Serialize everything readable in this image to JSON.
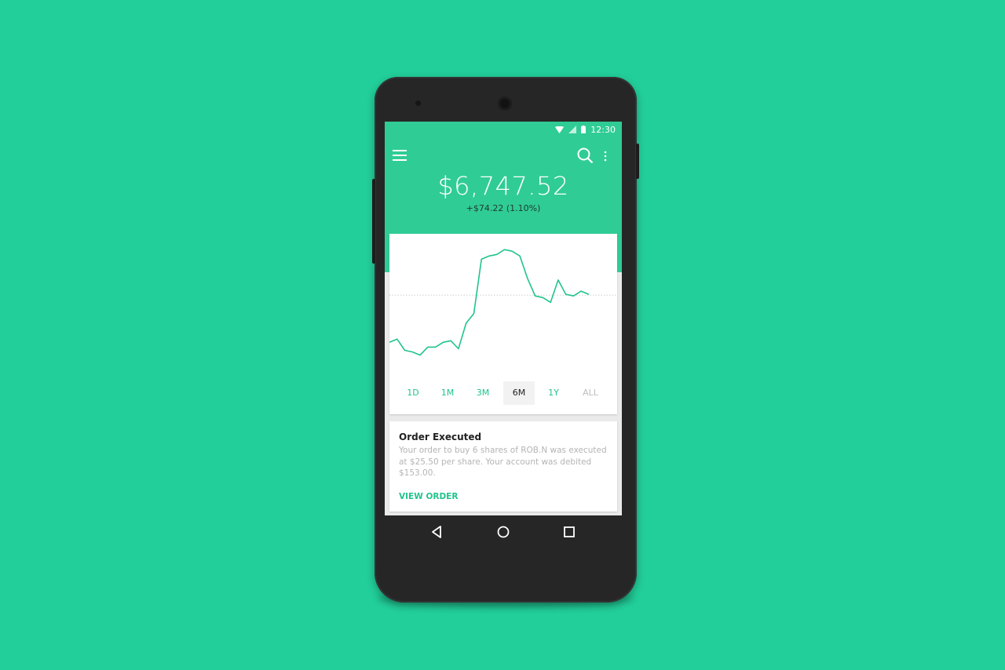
{
  "colors": {
    "background": "#22ce99",
    "header": "#30cc96",
    "accent": "#21c48b",
    "phone_body": "#262626"
  },
  "status_bar": {
    "time": "12:30",
    "icons": [
      "wifi-icon",
      "signal-icon",
      "battery-icon"
    ]
  },
  "toolbar": {
    "menu_icon": "hamburger-menu-icon",
    "search_icon": "search-icon",
    "more_icon": "overflow-menu-icon"
  },
  "portfolio": {
    "balance": "$6,747.52",
    "change": "+$74.22 (1.10%)"
  },
  "chart_data": {
    "type": "line",
    "series": [
      {
        "values": [
          38,
          40,
          33,
          32,
          30,
          35,
          35,
          38,
          39,
          34,
          50,
          56,
          90,
          92,
          93,
          96,
          95,
          92,
          78,
          67,
          66,
          63,
          77,
          68,
          67,
          70,
          68
        ]
      }
    ],
    "baseline": 67.5,
    "ylim": [
      20,
      100
    ],
    "grid": false
  },
  "ranges": {
    "options": [
      "1D",
      "1M",
      "3M",
      "6M",
      "1Y",
      "ALL"
    ],
    "selected": "6M"
  },
  "order": {
    "title": "Order Executed",
    "body": "Your order to buy 6 shares of ROB.N was executed at $25.50 per share. Your account was debited $153.00.",
    "action": "VIEW ORDER"
  },
  "nav": {
    "back_icon": "back-triangle-icon",
    "home_icon": "home-circle-icon",
    "recents_icon": "recents-square-icon"
  }
}
